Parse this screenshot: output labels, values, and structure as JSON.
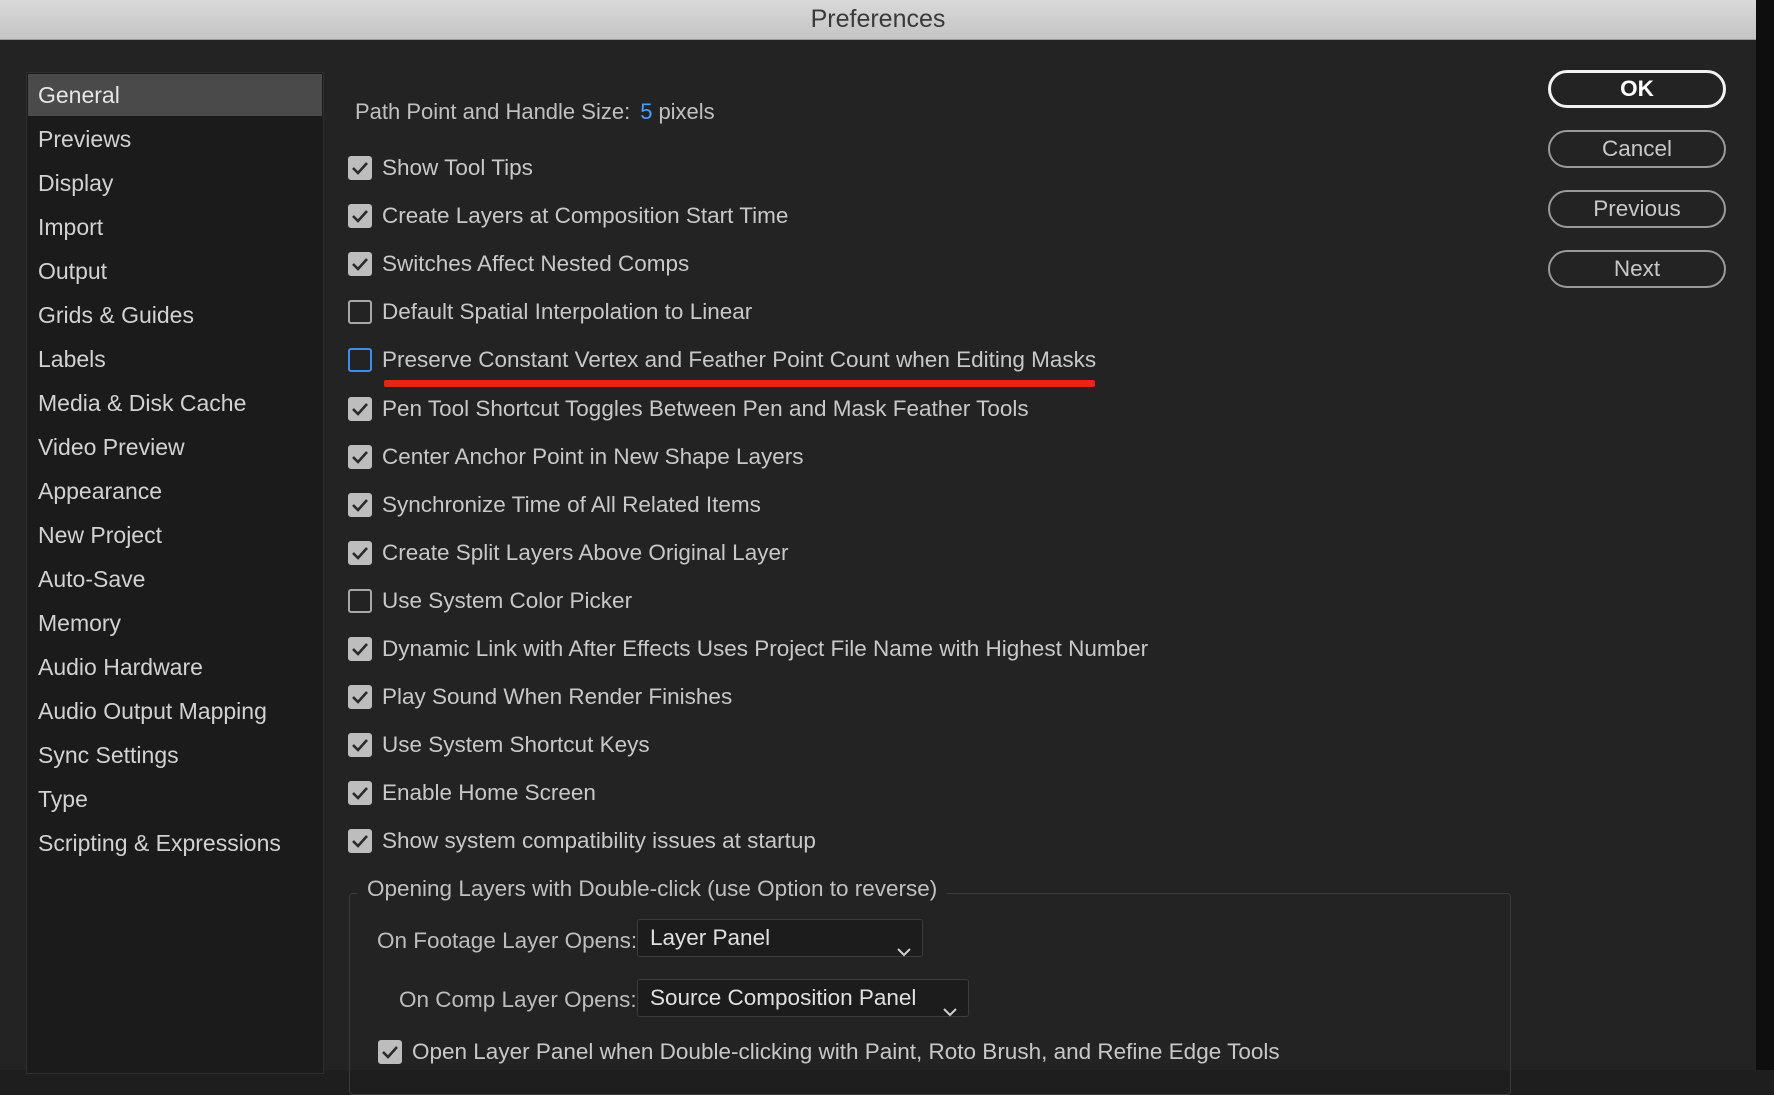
{
  "window": {
    "title": "Preferences"
  },
  "sidebar": {
    "items": [
      {
        "label": "General",
        "active": true
      },
      {
        "label": "Previews"
      },
      {
        "label": "Display"
      },
      {
        "label": "Import"
      },
      {
        "label": "Output"
      },
      {
        "label": "Grids & Guides"
      },
      {
        "label": "Labels"
      },
      {
        "label": "Media & Disk Cache"
      },
      {
        "label": "Video Preview"
      },
      {
        "label": "Appearance"
      },
      {
        "label": "New Project"
      },
      {
        "label": "Auto-Save"
      },
      {
        "label": "Memory"
      },
      {
        "label": "Audio Hardware"
      },
      {
        "label": "Audio Output Mapping"
      },
      {
        "label": "Sync Settings"
      },
      {
        "label": "Type"
      },
      {
        "label": "Scripting & Expressions"
      }
    ]
  },
  "general": {
    "path_point_label": "Path Point and Handle Size:",
    "path_point_value": "5",
    "path_point_unit": "pixels",
    "checkboxes": [
      {
        "label": "Show Tool Tips",
        "checked": true
      },
      {
        "label": "Create Layers at Composition Start Time",
        "checked": true
      },
      {
        "label": "Switches Affect Nested Comps",
        "checked": true
      },
      {
        "label": "Default Spatial Interpolation to Linear",
        "checked": false
      },
      {
        "label": "Preserve Constant Vertex and Feather Point Count when Editing Masks",
        "checked": false,
        "focused": true
      },
      {
        "label": "Pen Tool Shortcut Toggles Between Pen and Mask Feather Tools",
        "checked": true
      },
      {
        "label": "Center Anchor Point in New Shape Layers",
        "checked": true
      },
      {
        "label": "Synchronize Time of All Related Items",
        "checked": true
      },
      {
        "label": "Create Split Layers Above Original Layer",
        "checked": true
      },
      {
        "label": "Use System Color Picker",
        "checked": false
      },
      {
        "label": "Dynamic Link with After Effects Uses Project File Name with Highest Number",
        "checked": true
      },
      {
        "label": "Play Sound When Render Finishes",
        "checked": true
      },
      {
        "label": "Use System Shortcut Keys",
        "checked": true
      },
      {
        "label": "Enable Home Screen",
        "checked": true
      },
      {
        "label": "Show system compatibility issues at startup",
        "checked": true
      }
    ],
    "double_click_group": {
      "title": "Opening Layers with Double-click (use Option to reverse)",
      "footage_label": "On Footage Layer Opens:",
      "footage_value": "Layer Panel",
      "comp_label": "On Comp Layer Opens:",
      "comp_value": "Source Composition Panel",
      "open_layer_panel_label": "Open Layer Panel when Double-clicking with Paint, Roto Brush, and Refine Edge Tools",
      "open_layer_panel_checked": true
    }
  },
  "buttons": {
    "ok": "OK",
    "cancel": "Cancel",
    "previous": "Previous",
    "next": "Next"
  },
  "colors": {
    "accent_value": "#4a9eff",
    "focus_ring": "#3d8ee8",
    "annotation_underline": "#e8231a"
  }
}
